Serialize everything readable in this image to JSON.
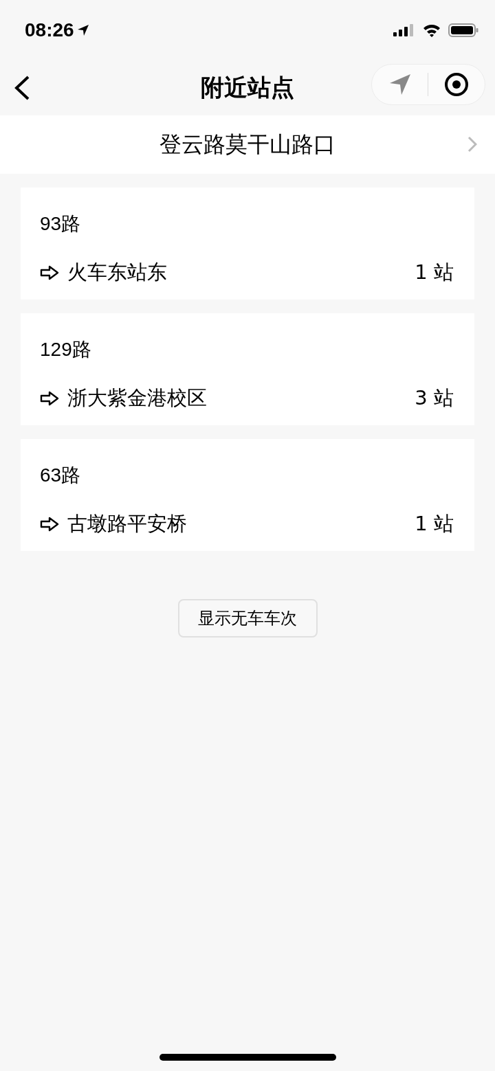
{
  "status_bar": {
    "time": "08:26"
  },
  "nav": {
    "title": "附近站点"
  },
  "station": {
    "name": "登云路莫干山路口"
  },
  "routes": [
    {
      "name": "93路",
      "direction": "火车东站东",
      "stops": "1 站"
    },
    {
      "name": "129路",
      "direction": "浙大紫金港校区",
      "stops": "3 站"
    },
    {
      "name": "63路",
      "direction": "古墩路平安桥",
      "stops": "1 站"
    }
  ],
  "toggle_button": {
    "label": "显示无车车次"
  }
}
